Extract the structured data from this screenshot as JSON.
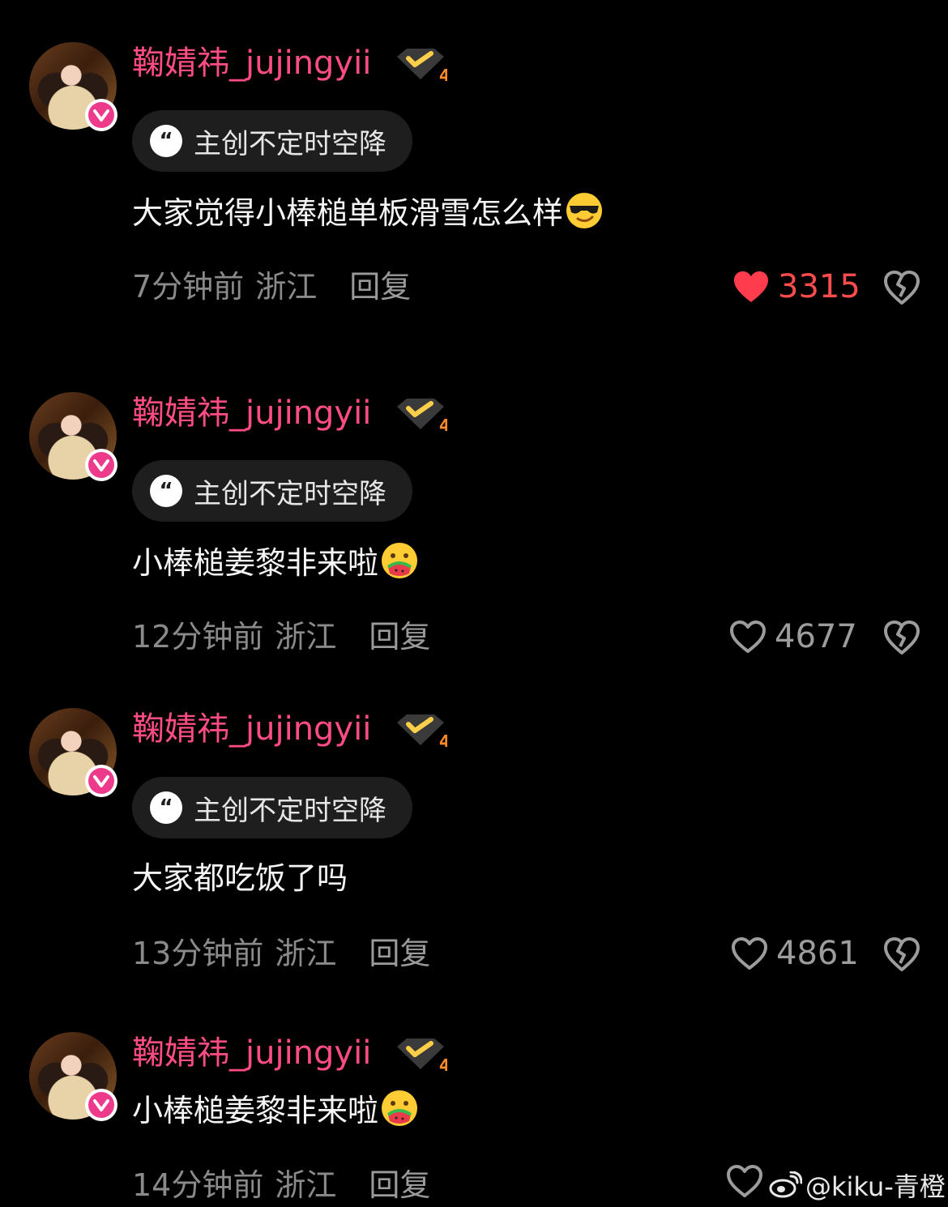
{
  "comments": [
    {
      "username": "鞠婧祎_jujingyii",
      "level": "4",
      "tag": "主创不定时空降",
      "text": "大家觉得小棒槌单板滑雪怎么样",
      "emoji": "sunglasses-emoji",
      "time": "7分钟前",
      "region": "浙江",
      "reply": "回复",
      "likes": "3315",
      "liked": true
    },
    {
      "username": "鞠婧祎_jujingyii",
      "level": "4",
      "tag": "主创不定时空降",
      "text": "小棒槌姜黎非来啦",
      "emoji": "watermelon-eating-emoji",
      "time": "12分钟前",
      "region": "浙江",
      "reply": "回复",
      "likes": "4677",
      "liked": false
    },
    {
      "username": "鞠婧祎_jujingyii",
      "level": "4",
      "tag": "主创不定时空降",
      "text": "大家都吃饭了吗",
      "emoji": "",
      "time": "13分钟前",
      "region": "浙江",
      "reply": "回复",
      "likes": "4861",
      "liked": false
    },
    {
      "username": "鞠婧祎_jujingyii",
      "level": "4",
      "tag": "",
      "text": "小棒槌姜黎非来啦",
      "emoji": "watermelon-eating-emoji",
      "time": "14分钟前",
      "region": "浙江",
      "reply": "回复",
      "likes": "",
      "liked": false
    }
  ],
  "watermark": {
    "text": "@kiku-青橙",
    "icon": "weibo-icon"
  },
  "colors": {
    "background": "#000000",
    "username": "#ff4d84",
    "liked": "#ff4d4d",
    "meta": "#8a8a8a",
    "verified": "#ee3a8a"
  }
}
